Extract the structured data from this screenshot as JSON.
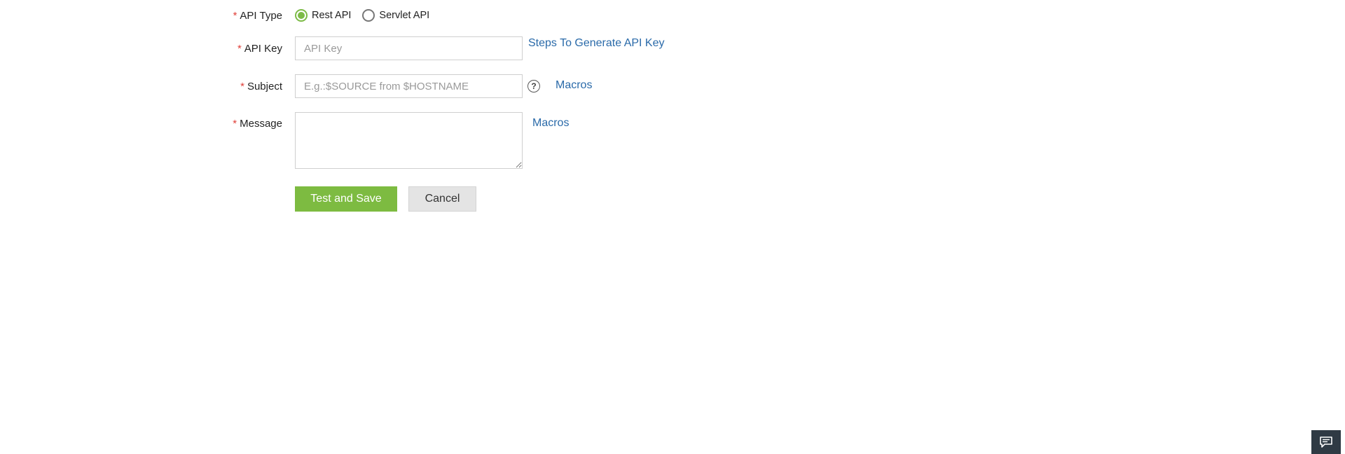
{
  "form": {
    "required_mark": "*",
    "api_type": {
      "label": "API Type",
      "options": [
        {
          "label": "Rest API",
          "selected": true
        },
        {
          "label": "Servlet API",
          "selected": false
        }
      ]
    },
    "api_key": {
      "label": "API Key",
      "placeholder": "API Key",
      "value": "",
      "link": "Steps To Generate API Key"
    },
    "subject": {
      "label": "Subject",
      "placeholder": "E.g.:$SOURCE from $HOSTNAME",
      "value": "",
      "help_icon": "question-circle-icon",
      "macros_link": "Macros"
    },
    "message": {
      "label": "Message",
      "value": "",
      "macros_link": "Macros"
    }
  },
  "actions": {
    "test_and_save": "Test and Save",
    "cancel": "Cancel"
  },
  "colors": {
    "accent_green": "#7dbb41",
    "link_blue": "#2a6aa9",
    "required_red": "#e0413a"
  },
  "chat_widget": {
    "icon": "chat-icon"
  }
}
